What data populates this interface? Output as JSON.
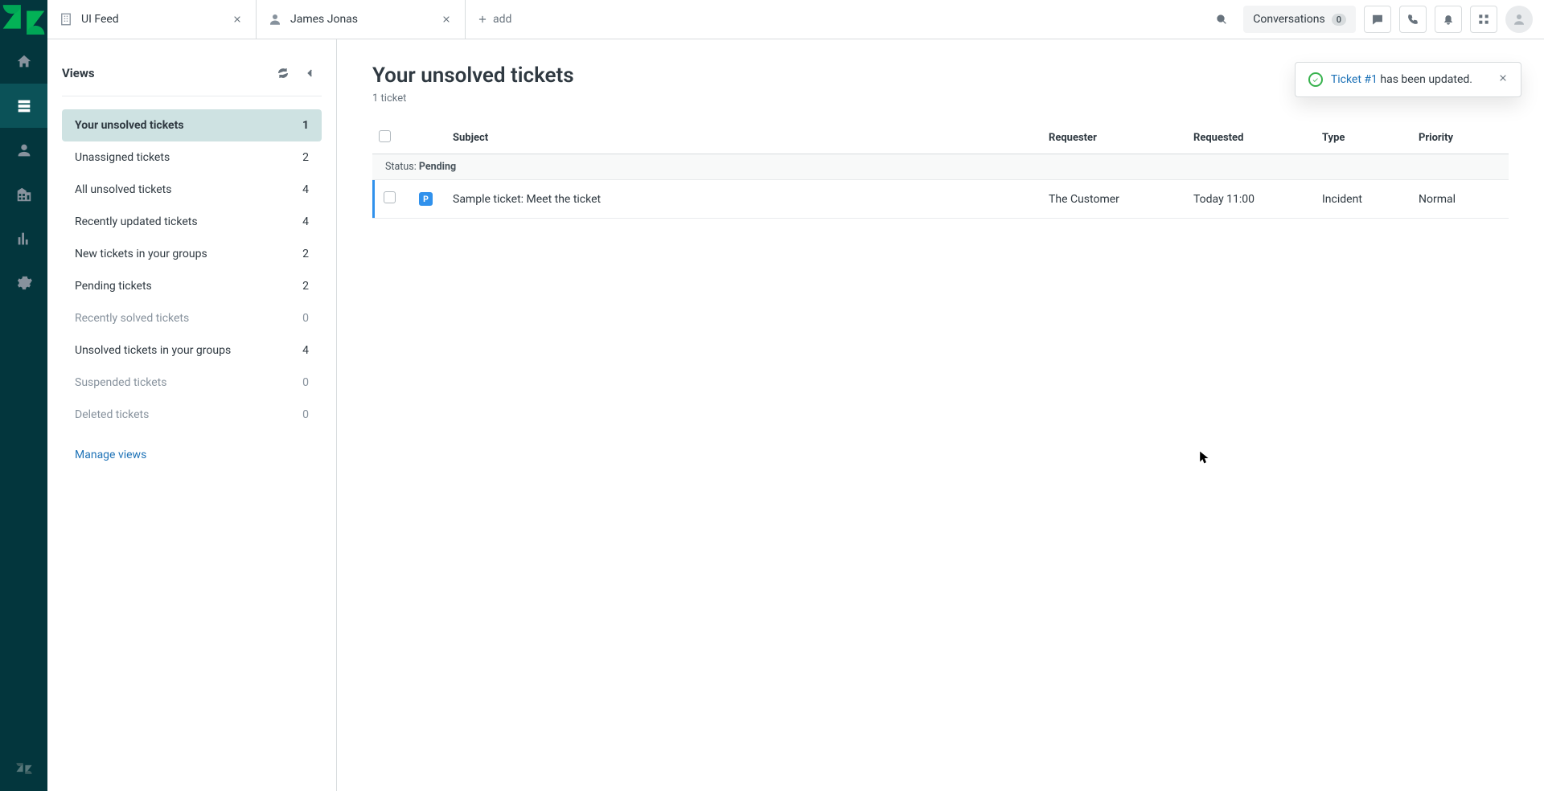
{
  "tabs": [
    {
      "label": "UI Feed",
      "kind": "org"
    },
    {
      "label": "James Jonas",
      "kind": "user"
    }
  ],
  "add_tab_label": "add",
  "top": {
    "conversations_label": "Conversations",
    "conversations_count": "0"
  },
  "views": {
    "title": "Views",
    "manage_link": "Manage views",
    "items": [
      {
        "label": "Your unsolved tickets",
        "count": "1",
        "active": true
      },
      {
        "label": "Unassigned tickets",
        "count": "2"
      },
      {
        "label": "All unsolved tickets",
        "count": "4"
      },
      {
        "label": "Recently updated tickets",
        "count": "4"
      },
      {
        "label": "New tickets in your groups",
        "count": "2"
      },
      {
        "label": "Pending tickets",
        "count": "2"
      },
      {
        "label": "Recently solved tickets",
        "count": "0"
      },
      {
        "label": "Unsolved tickets in your groups",
        "count": "4"
      },
      {
        "label": "Suspended tickets",
        "count": "0"
      },
      {
        "label": "Deleted tickets",
        "count": "0"
      }
    ]
  },
  "content": {
    "title": "Your unsolved tickets",
    "subtitle": "1 ticket",
    "columns": {
      "subject": "Subject",
      "requester": "Requester",
      "requested": "Requested",
      "type": "Type",
      "priority": "Priority"
    },
    "status_group": {
      "prefix": "Status: ",
      "value": "Pending"
    },
    "rows": [
      {
        "badge": "P",
        "subject": "Sample ticket: Meet the ticket",
        "requester": "The Customer",
        "requested": "Today 11:00",
        "type": "Incident",
        "priority": "Normal"
      }
    ]
  },
  "toast": {
    "link_text": "Ticket #1",
    "rest_text": " has been updated."
  },
  "colors": {
    "rail_bg": "#03363d",
    "accent_blue": "#3091ec",
    "link_blue": "#1f73b7",
    "active_view_bg": "#cee2e2",
    "success_green": "#37b24d"
  }
}
